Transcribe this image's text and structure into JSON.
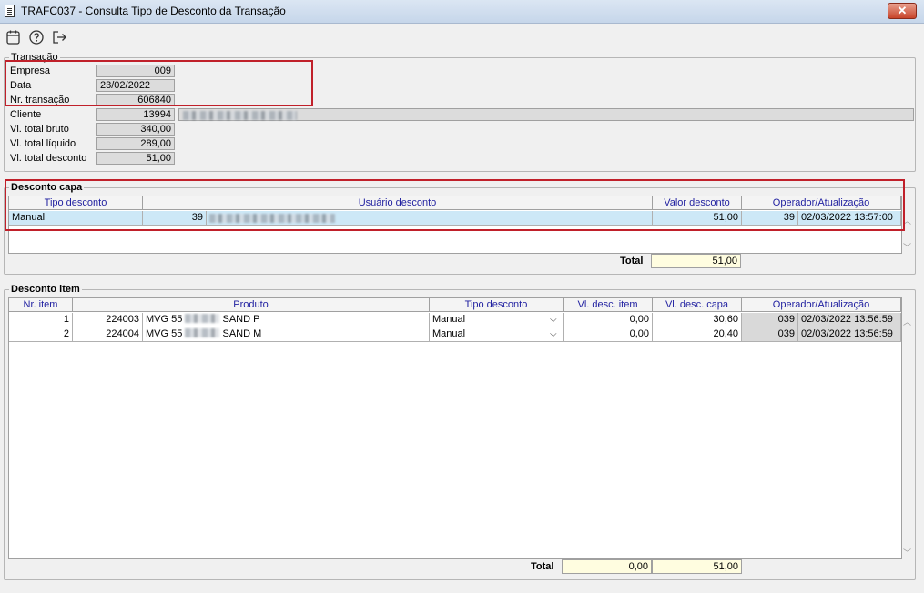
{
  "window": {
    "title": "TRAFC037 - Consulta Tipo de Desconto da Transação",
    "close_label": "✕"
  },
  "toolbar": {
    "icons": [
      "calendar-icon",
      "help-icon",
      "exit-icon"
    ]
  },
  "transacao": {
    "legend": "Transação",
    "fields": {
      "empresa_label": "Empresa",
      "empresa": "009",
      "data_label": "Data",
      "data": "23/02/2022",
      "nr_label": "Nr. transação",
      "nr": "606840",
      "cliente_label": "Cliente",
      "cliente": "13994",
      "bruto_label": "Vl. total bruto",
      "bruto": "340,00",
      "liquido_label": "Vl. total líquido",
      "liquido": "289,00",
      "desconto_label": "Vl. total desconto",
      "desconto": "51,00"
    }
  },
  "capa": {
    "legend": "Desconto capa",
    "headers": [
      "Tipo desconto",
      "Usuário desconto",
      "Valor desconto",
      "Operador/Atualização"
    ],
    "row": {
      "tipo": "Manual",
      "usuario": "39",
      "valor": "51,00",
      "operador": "39",
      "atualizacao": "02/03/2022 13:57:00"
    },
    "total_label": "Total",
    "total": "51,00"
  },
  "item": {
    "legend": "Desconto item",
    "headers": [
      "Nr. item",
      "Produto",
      "Tipo desconto",
      "Vl. desc. item",
      "Vl. desc. capa",
      "Operador/Atualização"
    ],
    "rows": [
      {
        "nr": "1",
        "codigo": "224003",
        "produto_a": "MVG 55",
        "produto_b": "SAND P",
        "tipo": "Manual",
        "desc_item": "0,00",
        "desc_capa": "30,60",
        "operador": "039",
        "atualizacao": "02/03/2022 13:56:59"
      },
      {
        "nr": "2",
        "codigo": "224004",
        "produto_a": "MVG 55",
        "produto_b": "SAND M",
        "tipo": "Manual",
        "desc_item": "0,00",
        "desc_capa": "20,40",
        "operador": "039",
        "atualizacao": "02/03/2022 13:56:59"
      }
    ],
    "total_label": "Total",
    "total_item": "0,00",
    "total_capa": "51,00"
  },
  "colors": {
    "selected_row": "#cde8f7",
    "highlight_border": "#c0202a",
    "header_text": "#1f1fa0",
    "total_bg": "#fffde0"
  }
}
